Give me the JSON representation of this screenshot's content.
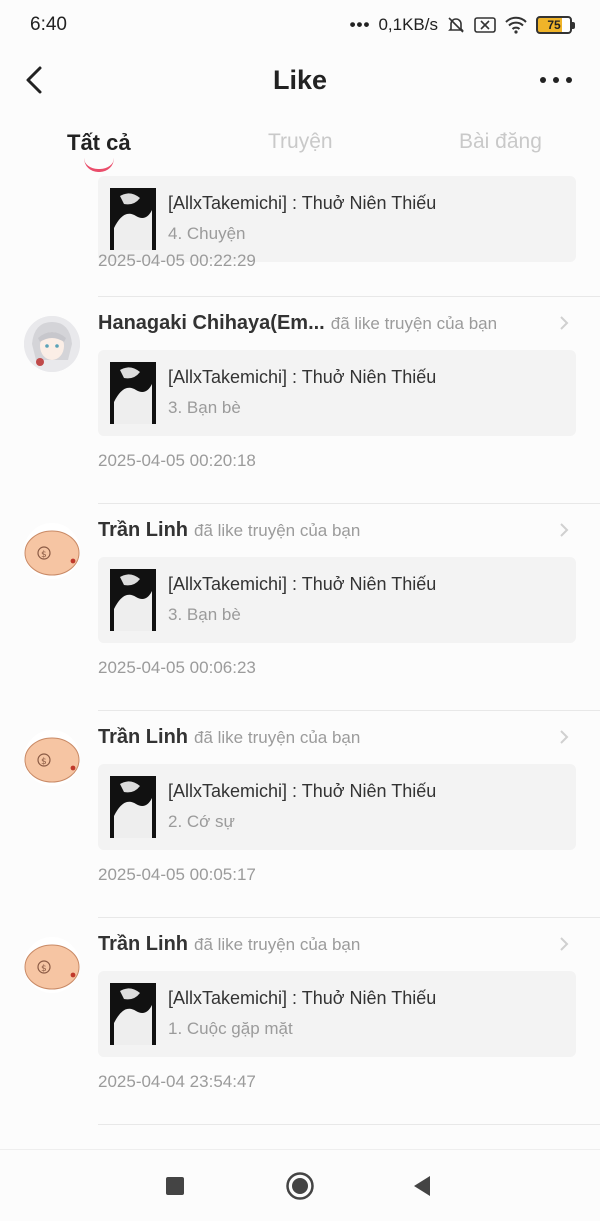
{
  "status": {
    "time": "6:40",
    "network_speed": "0,1KB/s",
    "battery": "75"
  },
  "header": {
    "title": "Like"
  },
  "tabs": [
    {
      "label": "Tất cả",
      "active": true
    },
    {
      "label": "Truyện",
      "active": false
    },
    {
      "label": "Bài đăng",
      "active": false
    }
  ],
  "notifications": [
    {
      "user": "",
      "action": "",
      "story_title": "[AllxTakemichi] : Thuở Niên Thiếu",
      "chapter": "4. Chuyện",
      "timestamp": "2025-04-05 00:22:29"
    },
    {
      "user": "Hanagaki Chihaya(Em...",
      "action": "đã like truyện của bạn",
      "story_title": "[AllxTakemichi] : Thuở Niên Thiếu",
      "chapter": "3. Bạn bè",
      "timestamp": "2025-04-05 00:20:18"
    },
    {
      "user": "Trần Linh",
      "action": "đã like truyện của bạn",
      "story_title": "[AllxTakemichi] : Thuở Niên Thiếu",
      "chapter": "3. Bạn bè",
      "timestamp": "2025-04-05 00:06:23"
    },
    {
      "user": "Trần Linh",
      "action": "đã like truyện của bạn",
      "story_title": "[AllxTakemichi] : Thuở Niên Thiếu",
      "chapter": "2. Cớ sự",
      "timestamp": "2025-04-05 00:05:17"
    },
    {
      "user": "Trần Linh",
      "action": "đã like truyện của bạn",
      "story_title": "[AllxTakemichi] : Thuở Niên Thiếu",
      "chapter": "1. Cuộc gặp mặt",
      "timestamp": "2025-04-04 23:54:47"
    }
  ],
  "colors": {
    "accent": "#ea4d6b",
    "muted_text": "#9b9b9b",
    "card_bg": "#f3f3f3",
    "avatar_peach": "#f6c5a3"
  },
  "icons": {
    "back": "back-arrow-icon",
    "more": "more-dots-icon",
    "chevron": "chevron-right-icon",
    "nav_recent": "square-icon",
    "nav_home": "circle-icon",
    "nav_back": "triangle-back-icon"
  }
}
